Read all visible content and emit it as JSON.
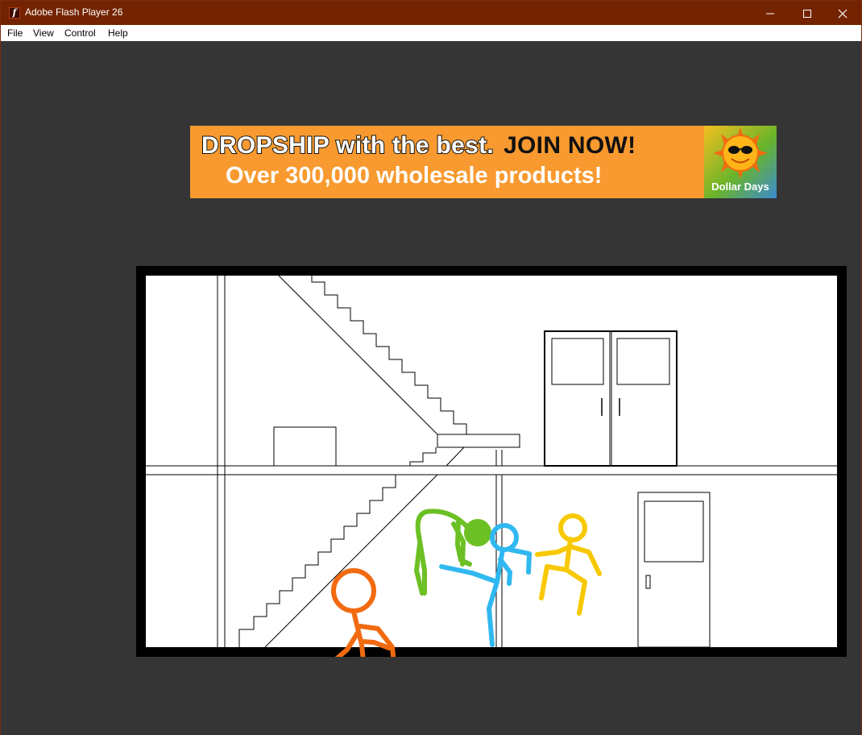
{
  "window": {
    "title": "Adobe Flash Player 26"
  },
  "controls": {
    "minimize": "—",
    "maximize": "☐",
    "close": "✕"
  },
  "menu": [
    "File",
    "View",
    "Control",
    "Help"
  ],
  "banner": {
    "line1_white": "DROPSHIP with the best.",
    "line1_dark": "JOIN NOW!",
    "line2": "Over 300,000 wholesale products!",
    "logo_text": "Dollar Days",
    "background": "#f89a30"
  },
  "scene": {
    "figure_colors": {
      "orange": "#f26a10",
      "green": "#6cc024",
      "blue": "#30b8f0",
      "yellow": "#f8c800"
    }
  }
}
